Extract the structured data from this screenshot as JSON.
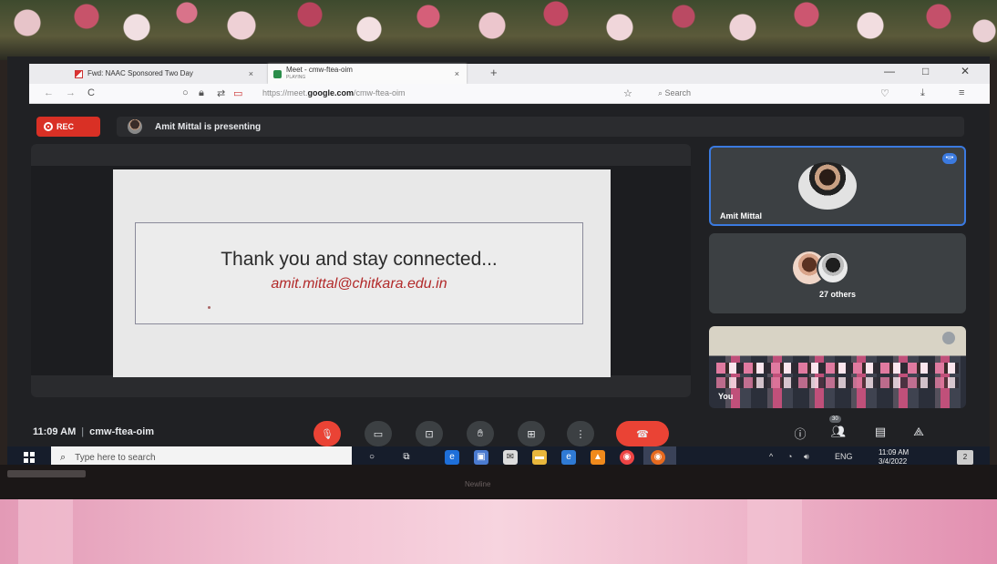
{
  "browser": {
    "tabs": [
      {
        "label": "Fwd: NAAC Sponsored Two Day",
        "icon": "gmail-icon",
        "close": "×"
      },
      {
        "label": "Meet - cmw-ftea-oim",
        "sublabel": "PLAYING",
        "icon": "meet-icon",
        "close": "×"
      }
    ],
    "new_tab": "+",
    "window_controls": {
      "minimize": "—",
      "maximize": "□",
      "close": "✕"
    },
    "url_prefix": "https://meet.",
    "url_domain": "google.com",
    "url_path": "/cmw-ftea-oim",
    "search_placeholder": "Search",
    "nav": {
      "back": "←",
      "forward": "→",
      "reload": "C"
    }
  },
  "meet": {
    "rec_label": "REC",
    "presenting_text": "Amit Mittal is presenting",
    "slide": {
      "line1": "Thank you and stay connected...",
      "line2": "amit.mittal@chitkara.edu.in"
    },
    "tiles": {
      "main_name": "Amit Mittal",
      "others_label": "27 others",
      "self_label": "You"
    },
    "time": "11:09 AM",
    "separator": "|",
    "meeting_code": "cmw-ftea-oim",
    "participant_count": "30"
  },
  "taskbar": {
    "search_placeholder": "Type here to search",
    "tray_lang": "ENG",
    "clock_time": "11:09 AM",
    "clock_date": "3/4/2022",
    "notification_count": "2"
  },
  "monitor": {
    "brand": "Newline"
  }
}
